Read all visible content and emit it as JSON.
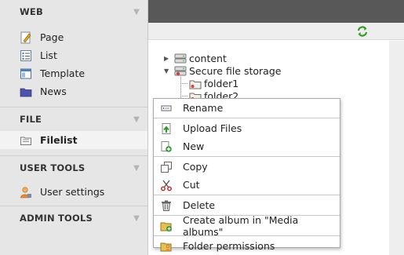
{
  "sidebar": {
    "web": {
      "title": "WEB",
      "items": [
        {
          "label": "Page",
          "icon": "page-icon"
        },
        {
          "label": "List",
          "icon": "list-icon"
        },
        {
          "label": "Template",
          "icon": "template-icon"
        },
        {
          "label": "News",
          "icon": "news-folder-icon"
        }
      ]
    },
    "file": {
      "title": "FILE",
      "items": [
        {
          "label": "Filelist",
          "icon": "filelist-icon",
          "active": true
        }
      ]
    },
    "user_tools": {
      "title": "USER TOOLS",
      "items": [
        {
          "label": "User settings",
          "icon": "user-settings-icon"
        }
      ]
    },
    "admin_tools": {
      "title": "ADMIN TOOLS"
    }
  },
  "tree": {
    "nodes": [
      {
        "label": "content",
        "expanded": false
      },
      {
        "label": "Secure file storage",
        "expanded": true
      },
      {
        "label": "folder1"
      },
      {
        "label": "folder2"
      }
    ]
  },
  "context_menu": {
    "items": [
      {
        "label": "Rename",
        "icon": "rename-icon"
      },
      {
        "label": "Upload Files",
        "icon": "upload-icon"
      },
      {
        "label": "New",
        "icon": "new-file-icon"
      },
      {
        "label": "Copy",
        "icon": "copy-icon"
      },
      {
        "label": "Cut",
        "icon": "cut-icon"
      },
      {
        "label": "Delete",
        "icon": "delete-icon"
      },
      {
        "label": "Create album in \"Media albums\"",
        "icon": "create-album-icon"
      },
      {
        "label": "Folder permissions",
        "icon": "folder-permissions-icon"
      }
    ]
  },
  "colors": {
    "topbar": "#585858",
    "sidebar_bg": "#e6e6e6",
    "refresh_green": "#3a9a2a"
  }
}
